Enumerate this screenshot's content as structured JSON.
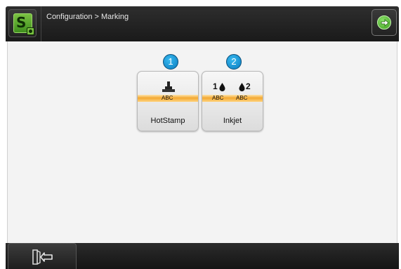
{
  "header": {
    "breadcrumb": "Configuration > Marking",
    "logo_icon": "s-logo-icon",
    "next_icon": "arrow-right-circle-icon"
  },
  "tiles": [
    {
      "badge": "1",
      "label": "HotStamp",
      "sub": "ABC",
      "icon": "stamp-icon"
    },
    {
      "badge": "2",
      "label": "Inkjet",
      "sub_left": "ABC",
      "sub_right": "ABC",
      "head_left": "1",
      "head_right": "2",
      "icon": "inkjet-drops-icon"
    }
  ],
  "footer": {
    "exit_icon": "exit-door-icon"
  },
  "colors": {
    "accent_green": "#7ac142",
    "badge_blue": "#1a9bd7",
    "stripe_orange": "#f4a528",
    "bar_dark": "#1e1e1e"
  }
}
